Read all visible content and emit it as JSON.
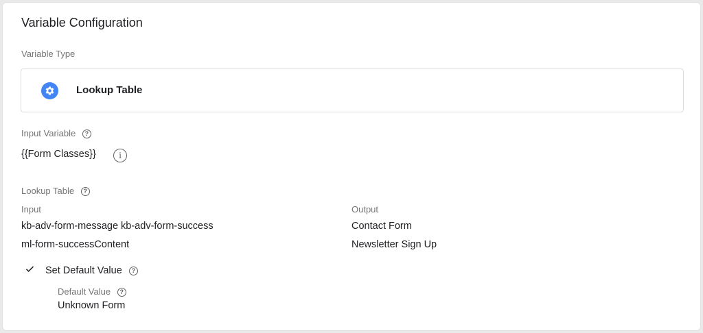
{
  "panel": {
    "title": "Variable Configuration"
  },
  "variable_type": {
    "label": "Variable Type",
    "icon": "gear-icon",
    "name": "Lookup Table",
    "icon_color": "#4285f4"
  },
  "input_variable": {
    "label": "Input Variable",
    "value": "{{Form Classes}}"
  },
  "lookup_table": {
    "label": "Lookup Table",
    "headers": {
      "input": "Input",
      "output": "Output"
    },
    "rows": [
      {
        "input": "kb-adv-form-message kb-adv-form-success",
        "output": "Contact Form"
      },
      {
        "input": "ml-form-successContent",
        "output": "Newsletter Sign Up"
      }
    ]
  },
  "default_value": {
    "checkbox_label": "Set Default Value",
    "checked": true,
    "label": "Default Value",
    "value": "Unknown Form"
  }
}
